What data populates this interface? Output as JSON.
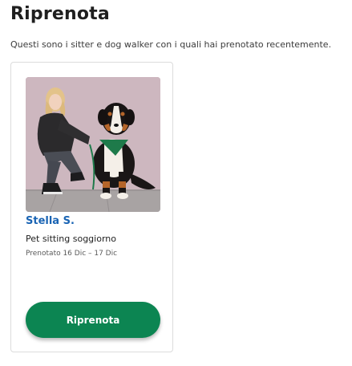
{
  "page": {
    "title": "Riprenota",
    "subtitle": "Questi sono i sitter e dog walker con i quali hai prenotato recentemente."
  },
  "cards": [
    {
      "sitter_name": "Stella S.",
      "service": "Pet sitting soggiorno",
      "dates": "Prenotato 16 Dic – 17 Dic",
      "button_label": "Riprenota",
      "photo_icon": "sitter-with-dog-photo"
    }
  ],
  "colors": {
    "link": "#1a64b4",
    "button": "#0c8552",
    "card_border": "#dcdcdc"
  }
}
